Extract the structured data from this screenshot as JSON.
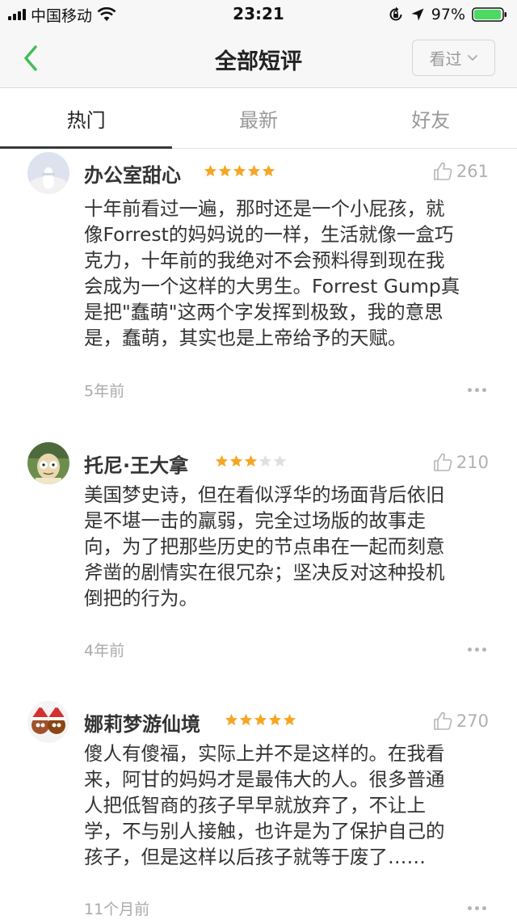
{
  "status_bar": {
    "carrier": "中国移动",
    "time": "23:21",
    "battery": "97%",
    "battery_level": 0.97,
    "colors": {
      "battery": "#4cd964"
    }
  },
  "nav": {
    "title": "全部短评",
    "seen_filter": "看过",
    "icons": [
      "chevron-left-icon",
      "chevron-down-icon"
    ],
    "colors": {
      "back_arrow": "#42bd56"
    }
  },
  "tabs": [
    {
      "label": "热门",
      "active": true
    },
    {
      "label": "最新",
      "active": false
    },
    {
      "label": "好友",
      "active": false
    }
  ],
  "comments": [
    {
      "username": "办公室甜心",
      "rating": 5,
      "likes": "261",
      "lines": [
        "十年前看过一遍，那时还是一个小屁孩，就",
        "像Forrest的妈妈说的一样，生活就像一盒巧",
        "克力，十年前的我绝对不会预料得到现在我",
        "会成为一个这样的大男生。Forrest Gump真",
        "是把\"蠢萌\"这两个字发挥到极致，我的意思",
        "是，蠢萌，其实也是上帝给予的天赋。"
      ],
      "time": "5年前"
    },
    {
      "username": "托尼·王大拿",
      "rating": 3,
      "likes": "210",
      "lines": [
        "美国梦史诗，但在看似浮华的场面背后依旧",
        "是不堪一击的羸弱，完全过场版的故事走",
        "向，为了把那些历史的节点串在一起而刻意",
        "斧凿的剧情实在很冗杂；坚决反对这种投机",
        "倒把的行为。"
      ],
      "time": "4年前"
    },
    {
      "username": "娜莉梦游仙境",
      "rating": 5,
      "likes": "270",
      "lines": [
        "傻人有傻福，实际上并不是这样的。在我看",
        "来，阿甘的妈妈才是最伟大的人。很多普通",
        "人把低智商的孩子早早就放弃了，不让上",
        "学，不与别人接触，也许是为了保护自己的",
        "孩子，但是这样以后孩子就等于废了……"
      ],
      "time": "11个月前"
    }
  ],
  "colors": {
    "star_filled": "#f5a623",
    "star_empty": "#e0e0e0",
    "meta_gray": "#aaaaaa"
  }
}
